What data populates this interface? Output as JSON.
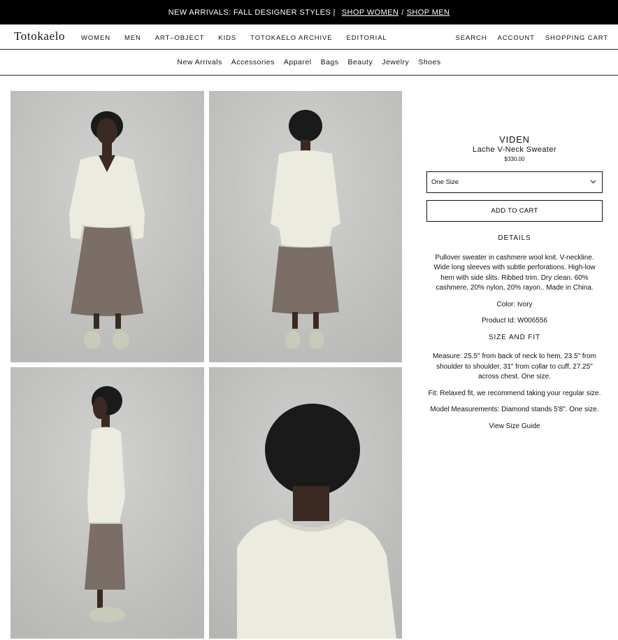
{
  "promo": {
    "text": "NEW ARRIVALS: FALL DESIGNER STYLES |",
    "shop_women": "SHOP WOMEN",
    "separator": "/",
    "shop_men": "SHOP MEN"
  },
  "header": {
    "logo": "Totokaelo",
    "nav": [
      "WOMEN",
      "MEN",
      "ART–OBJECT",
      "KIDS",
      "TOTOKAELO ARCHIVE",
      "EDITORIAL"
    ],
    "search": "SEARCH",
    "account": "ACCOUNT",
    "cart": "SHOPPING CART"
  },
  "subnav": [
    "New Arrivals",
    "Accessories",
    "Apparel",
    "Bags",
    "Beauty",
    "Jewelry",
    "Shoes"
  ],
  "product": {
    "brand": "VIDEN",
    "name": "Lache V-Neck Sweater",
    "price": "$330.00",
    "size_selected": "One Size",
    "add_to_cart": "ADD TO CART",
    "details_heading": "DETAILS",
    "description": "Pullover sweater in cashmere wool knit. V-neckline. Wide long sleeves with subtle perforations. High-low hem with side slits. Ribbed trim. Dry clean. 60% cashmere, 20% nylon, 20% rayon.. Made in China.",
    "color": "Color: Ivory",
    "product_id": "Product Id: W006556",
    "size_heading": "SIZE AND FIT",
    "measure": "Measure: 25.5\" from back of neck to hem, 23.5\" from shoulder to shoulder, 31\" from collar to cuff, 27.25\" across chest. One size.",
    "fit": "Fit: Relaxed fit, we recommend taking your regular size.",
    "model": "Model Measurements: Diamond stands 5'8\". One size.",
    "size_guide": "View Size Guide"
  },
  "colors": {
    "backdrop": "#c9c9c7",
    "sweater": "#ecebe0",
    "skirt": "#7b6e66",
    "skin": "#3a2a22",
    "hair": "#1a1a1a",
    "shoes": "#c9cbb9"
  }
}
